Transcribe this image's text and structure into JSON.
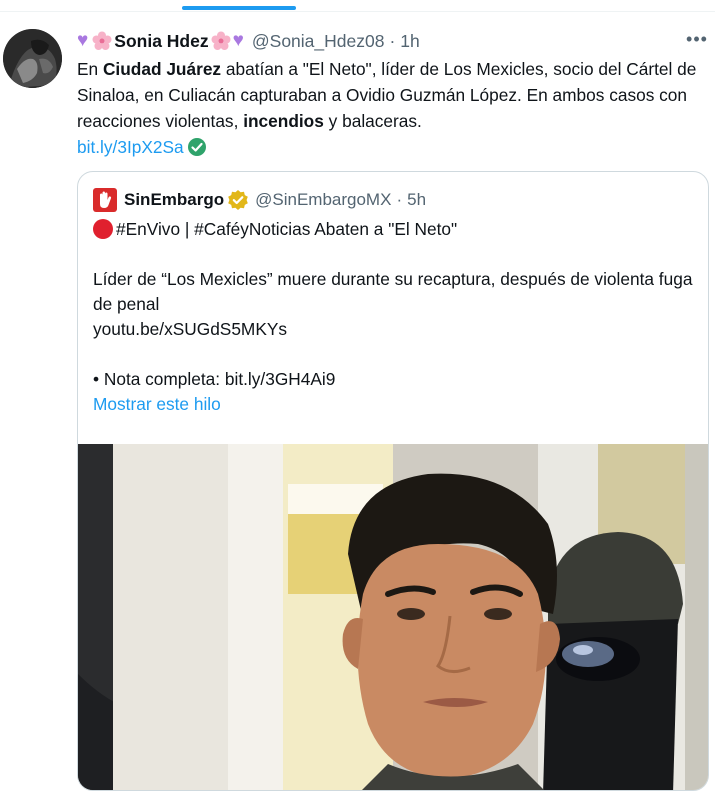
{
  "author": {
    "display_prefix": "💜🌸",
    "name": "Sonia Hdez",
    "display_suffix": "🌸💜",
    "handle": "@Sonia_Hdez08",
    "time": "1h"
  },
  "tweet": {
    "t1": "En ",
    "b1": "Ciudad Juárez",
    "t2": " abatían a \"El Neto\", líder de Los Mexicles, socio del Cártel de Sinaloa, en Culiacán capturaban a Ovidio Guzmán López. En ambos casos con reacciones violentas, ",
    "b2": "incendios",
    "t3": " y balaceras.",
    "link": "bit.ly/3IpX2Sa"
  },
  "quote": {
    "name": "SinEmbargo",
    "handle": "@SinEmbargoMX",
    "time": "5h",
    "line1": "#EnVivo | #CaféyNoticias Abaten a \"El Neto\"",
    "line2": "Líder de “Los Mexicles” muere durante su recaptura, después de violenta fuga de penal",
    "line3": "youtu.be/xSUGdS5MKYs",
    "line4": "• Nota completa: bit.ly/3GH4Ai9",
    "show_thread": "Mostrar este hilo"
  },
  "icons": {
    "more": "more-icon",
    "verified": "verified-badge-icon",
    "link_check": "check-circle-icon"
  },
  "colors": {
    "accent": "#1d9bf0",
    "text": "#0f1419",
    "muted": "#536471",
    "verified_gold": "#e2b719",
    "check_green": "#2fa36b"
  }
}
